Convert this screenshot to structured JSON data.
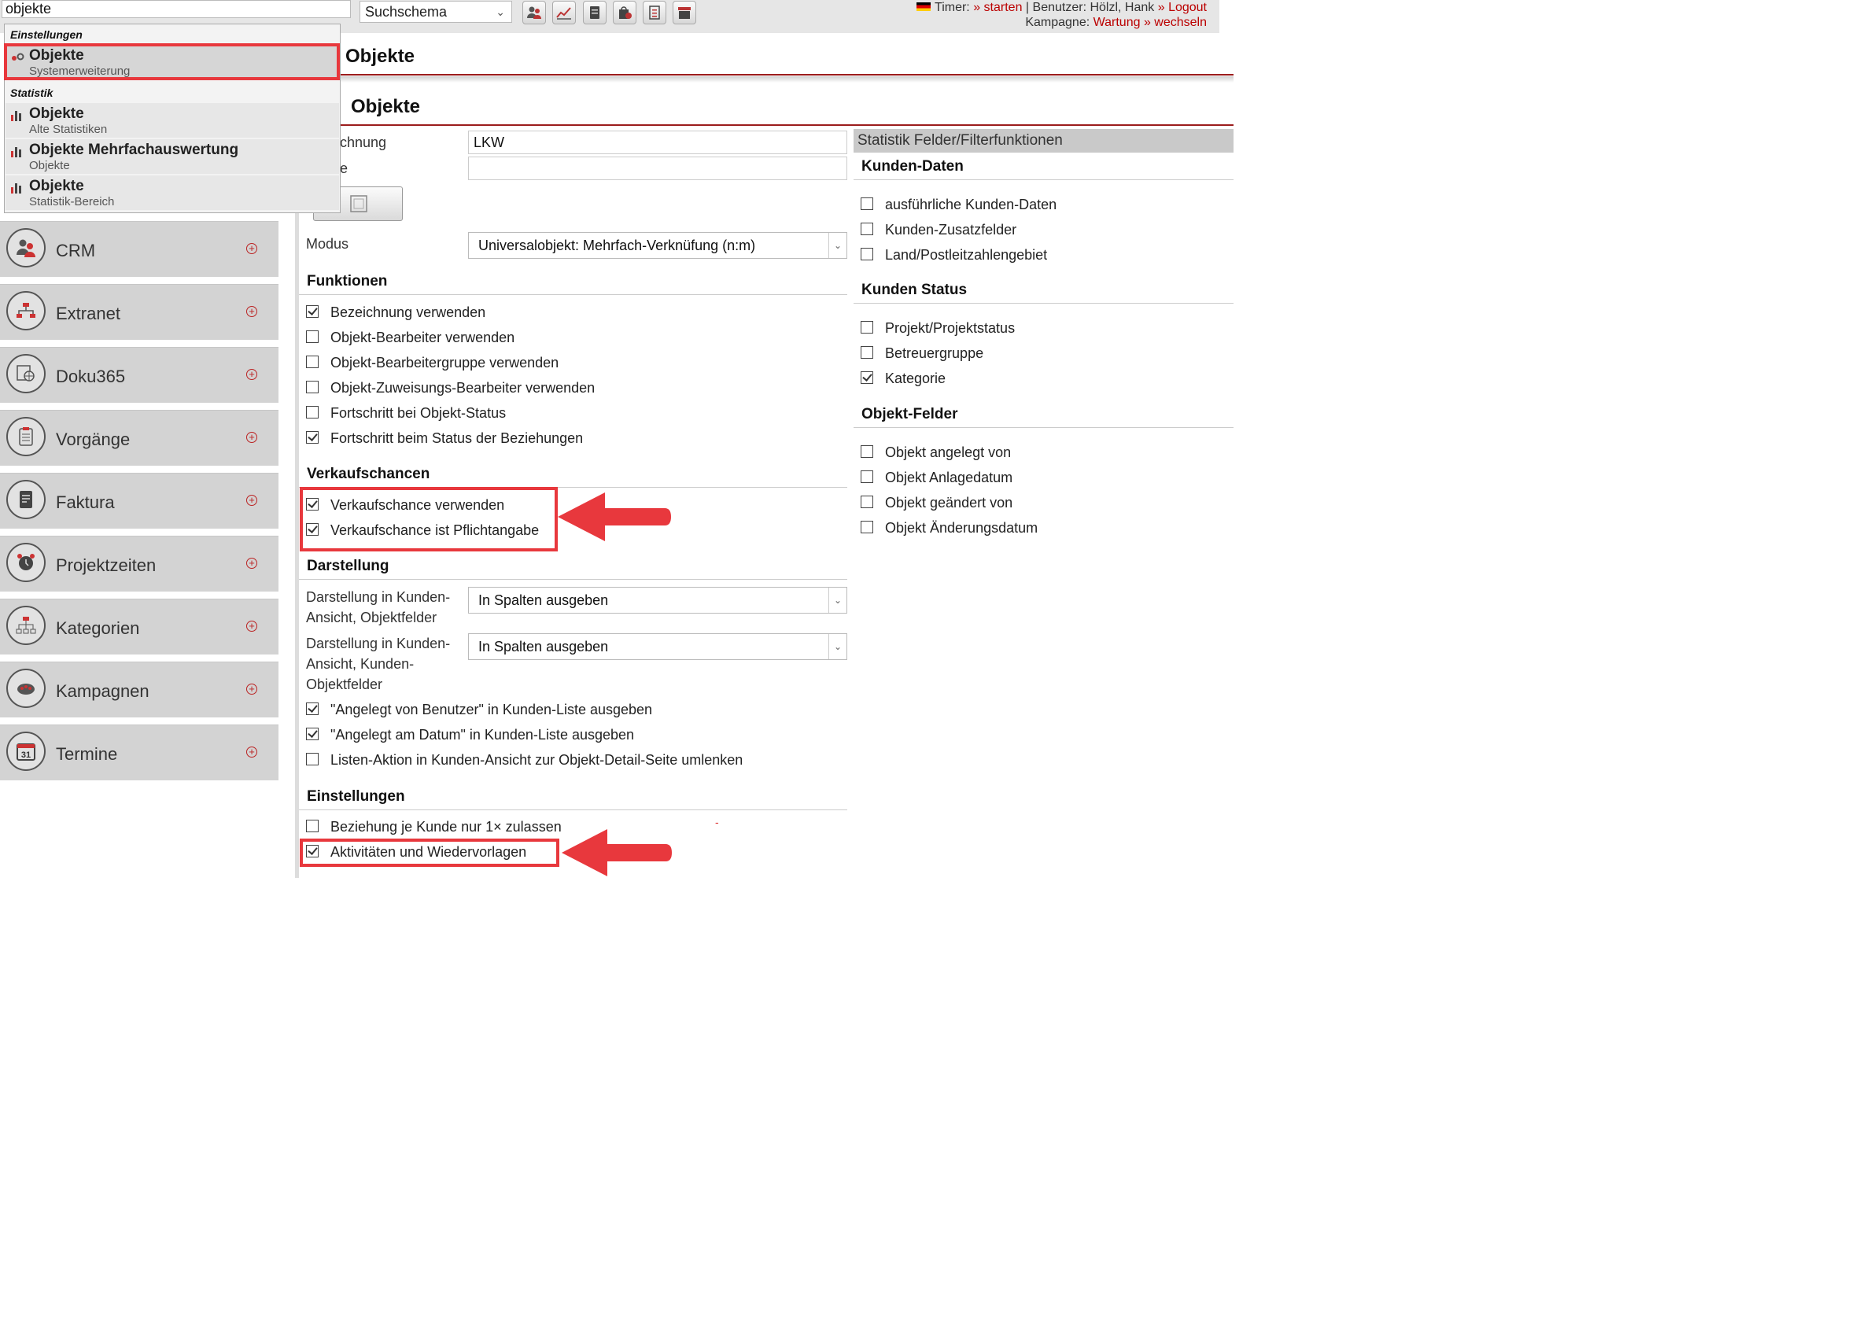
{
  "topbar": {
    "search_value": "objekte",
    "schema_label": "Suchschema",
    "timer_label": "Timer:",
    "timer_action": "» starten",
    "user_label": "| Benutzer: Hölzl, Hank",
    "logout": "» Logout",
    "campaign_label": "Kampagne:",
    "campaign_name": "Wartung",
    "campaign_change": "» wechseln",
    "toolbar_icons": [
      "crm-contacts-icon",
      "chart-icon",
      "invoice-icon",
      "shopping-bag-icon",
      "document-list-icon",
      "archive-icon"
    ]
  },
  "dropdown": {
    "cat_settings": "Einstellungen",
    "cat_stats": "Statistik",
    "items": [
      {
        "title": "Objekte",
        "sub": "Systemerweiterung"
      },
      {
        "title": "Objekte",
        "sub": "Alte Statistiken"
      },
      {
        "title": "Objekte Mehrfachauswertung",
        "sub": "Objekte"
      },
      {
        "title": "Objekte",
        "sub": "Statistik-Bereich"
      }
    ]
  },
  "sidebar": {
    "items": [
      {
        "label": "CRM",
        "icon": "users-icon"
      },
      {
        "label": "Extranet",
        "icon": "network-icon"
      },
      {
        "label": "Doku365",
        "icon": "globe-document-icon"
      },
      {
        "label": "Vorgänge",
        "icon": "clipboard-icon"
      },
      {
        "label": "Faktura",
        "icon": "invoice-icon"
      },
      {
        "label": "Projektzeiten",
        "icon": "alarm-clock-icon"
      },
      {
        "label": "Kategorien",
        "icon": "hierarchy-icon"
      },
      {
        "label": "Kampagnen",
        "icon": "campaign-icon"
      },
      {
        "label": "Termine",
        "icon": "calendar-icon"
      }
    ]
  },
  "page": {
    "title": "Objekte",
    "section_title": "Objekte"
  },
  "form": {
    "bezeichnung_label": "chnung",
    "bezeichnung_value": "LKW",
    "second_label": "e",
    "second_value": "",
    "modus_label": "Modus",
    "modus_value": "Universalobjekt: Mehrfach-Verknüfung (n:m)",
    "groups": {
      "funktionen": "Funktionen",
      "verkaufschancen": "Verkaufschancen",
      "darstellung": "Darstellung",
      "einstellungen": "Einstellungen"
    },
    "funktionen": [
      {
        "label": "Bezeichnung verwenden",
        "checked": true
      },
      {
        "label": "Objekt-Bearbeiter verwenden",
        "checked": false
      },
      {
        "label": "Objekt-Bearbeitergruppe verwenden",
        "checked": false
      },
      {
        "label": "Objekt-Zuweisungs-Bearbeiter verwenden",
        "checked": false
      },
      {
        "label": "Fortschritt bei Objekt-Status",
        "checked": false
      },
      {
        "label": "Fortschritt beim Status der Beziehungen",
        "checked": true
      }
    ],
    "verkaufschancen": [
      {
        "label": "Verkaufschance verwenden",
        "checked": true
      },
      {
        "label": "Verkaufschance ist Pflichtangabe",
        "checked": true
      }
    ],
    "darstellung_1_label_a": "Darstellung in Kunden-",
    "darstellung_1_label_b": "Ansicht, Objektfelder",
    "darstellung_1_value": "In Spalten ausgeben",
    "darstellung_2_label_a": "Darstellung in Kunden-",
    "darstellung_2_label_b": "Ansicht, Kunden-",
    "darstellung_2_label_c": "Objektfelder",
    "darstellung_2_value": "In Spalten ausgeben",
    "darstellung": [
      {
        "label": "\"Angelegt von Benutzer\" in Kunden-Liste ausgeben",
        "checked": true
      },
      {
        "label": "\"Angelegt am Datum\" in Kunden-Liste ausgeben",
        "checked": true
      },
      {
        "label": "Listen-Aktion in Kunden-Ansicht zur Objekt-Detail-Seite umlenken",
        "checked": false
      }
    ],
    "einstellungen": [
      {
        "label": "Beziehung je Kunde nur 1× zulassen",
        "checked": false
      },
      {
        "label": "Aktivitäten und Wiedervorlagen",
        "checked": true
      }
    ],
    "stray_mark": "-"
  },
  "right_panel": {
    "header": "Statistik Felder/Filterfunktionen",
    "groups": {
      "kunden_daten": "Kunden-Daten",
      "kunden_status": "Kunden Status",
      "objekt_felder": "Objekt-Felder"
    },
    "kunden_daten": [
      {
        "label": "ausführliche Kunden-Daten",
        "checked": false
      },
      {
        "label": "Kunden-Zusatzfelder",
        "checked": false
      },
      {
        "label": "Land/Postleitzahlengebiet",
        "checked": false
      }
    ],
    "kunden_status": [
      {
        "label": "Projekt/Projektstatus",
        "checked": false
      },
      {
        "label": "Betreuergruppe",
        "checked": false
      },
      {
        "label": "Kategorie",
        "checked": true
      }
    ],
    "objekt_felder": [
      {
        "label": "Objekt angelegt von",
        "checked": false
      },
      {
        "label": "Objekt Anlagedatum",
        "checked": false
      },
      {
        "label": "Objekt geändert von",
        "checked": false
      },
      {
        "label": "Objekt Änderungsdatum",
        "checked": false
      }
    ]
  },
  "colors": {
    "accent_red": "#9b1c1c",
    "annotation_red": "#e8383d",
    "sidebar_bg": "#d3d3d3"
  }
}
